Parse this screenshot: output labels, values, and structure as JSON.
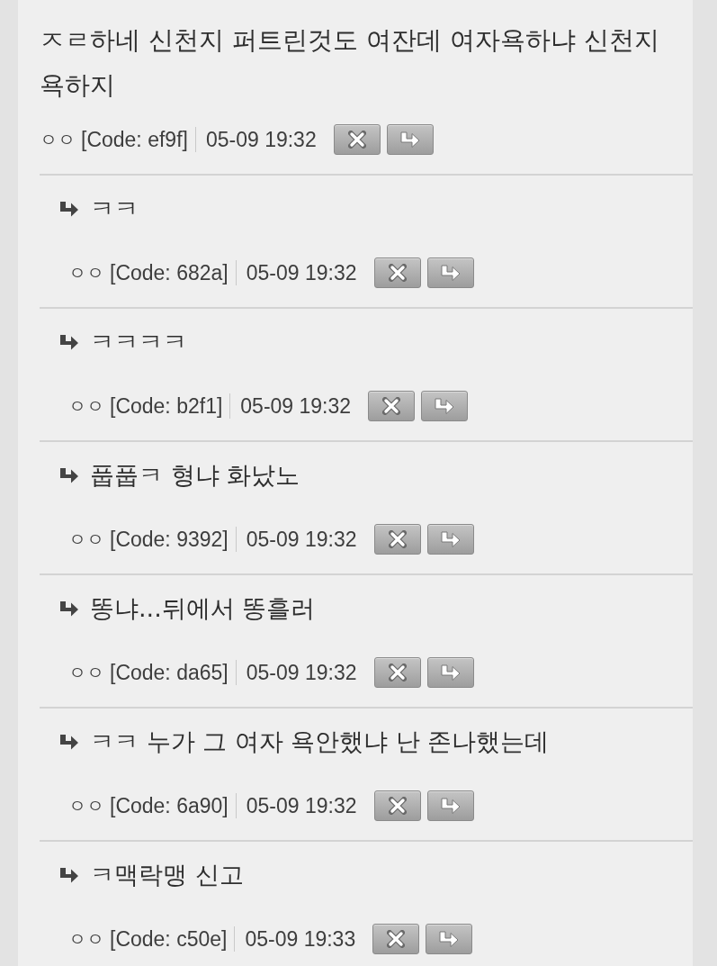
{
  "comment": {
    "text": "ㅈㄹ하네 신천지 퍼트린것도 여잔데 여자욕하냐 신천지 욕하지",
    "author": "ㅇㅇ",
    "code": "[Code: ef9f]",
    "time": "05-09 19:32"
  },
  "replies": [
    {
      "text": "ㅋㅋ",
      "author": "ㅇㅇ",
      "code": "[Code: 682a]",
      "time": "05-09 19:32"
    },
    {
      "text": "ㅋㅋㅋㅋ",
      "author": "ㅇㅇ",
      "code": "[Code: b2f1]",
      "time": "05-09 19:32"
    },
    {
      "text": "풉풉ㅋ 형냐 화났노",
      "author": "ㅇㅇ",
      "code": "[Code: 9392]",
      "time": "05-09 19:32"
    },
    {
      "text": "똥냐...뒤에서 똥흘러",
      "author": "ㅇㅇ",
      "code": "[Code: da65]",
      "time": "05-09 19:32"
    },
    {
      "text": "ㅋㅋ 누가 그 여자 욕안했냐 난 존나했는데",
      "author": "ㅇㅇ",
      "code": "[Code: 6a90]",
      "time": "05-09 19:32"
    },
    {
      "text": "ㅋ맥락맹 신고",
      "author": "ㅇㅇ",
      "code": "[Code: c50e]",
      "time": "05-09 19:33"
    }
  ]
}
